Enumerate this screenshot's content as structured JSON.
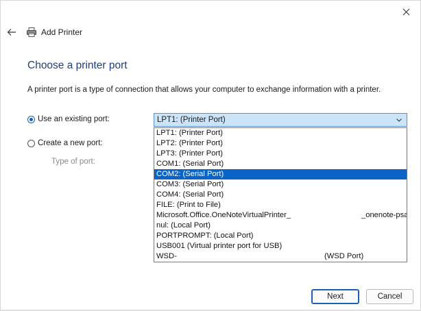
{
  "window": {
    "title": "Add Printer",
    "icons": {
      "close": "close-icon",
      "back": "back-arrow-icon",
      "printer": "printer-icon"
    }
  },
  "page": {
    "heading": "Choose a printer port",
    "description": "A printer port is a type of connection that allows your computer to exchange information with a printer."
  },
  "options": {
    "existing_label": "Use an existing port:",
    "existing_checked": true,
    "new_label": "Create a new port:",
    "new_checked": false,
    "type_label": "Type of port:"
  },
  "port_select": {
    "value": "LPT1: (Printer Port)",
    "items": [
      {
        "text": "LPT1: (Printer Port)"
      },
      {
        "text": "LPT2: (Printer Port)"
      },
      {
        "text": "LPT3: (Printer Port)"
      },
      {
        "text": "COM1: (Serial Port)"
      },
      {
        "text": "COM2: (Serial Port)",
        "highlighted": true
      },
      {
        "text": "COM3: (Serial Port)"
      },
      {
        "text": "COM4: (Serial Port)"
      },
      {
        "text": "FILE: (Print to File)"
      },
      {
        "text": "Microsoft.Office.OneNoteVirtualPrinter_",
        "tail": "_onenote-psa"
      },
      {
        "text": "nul: (Local Port)"
      },
      {
        "text": "PORTPROMPT: (Local Port)"
      },
      {
        "text": "USB001 (Virtual printer port for USB)"
      },
      {
        "text": "WSD-",
        "tail": "(WSD Port)"
      }
    ]
  },
  "buttons": {
    "next": "Next",
    "cancel": "Cancel"
  },
  "colors": {
    "accent": "#0a64c8",
    "heading": "#1f3d7a",
    "select_bg": "#cce4f7"
  }
}
